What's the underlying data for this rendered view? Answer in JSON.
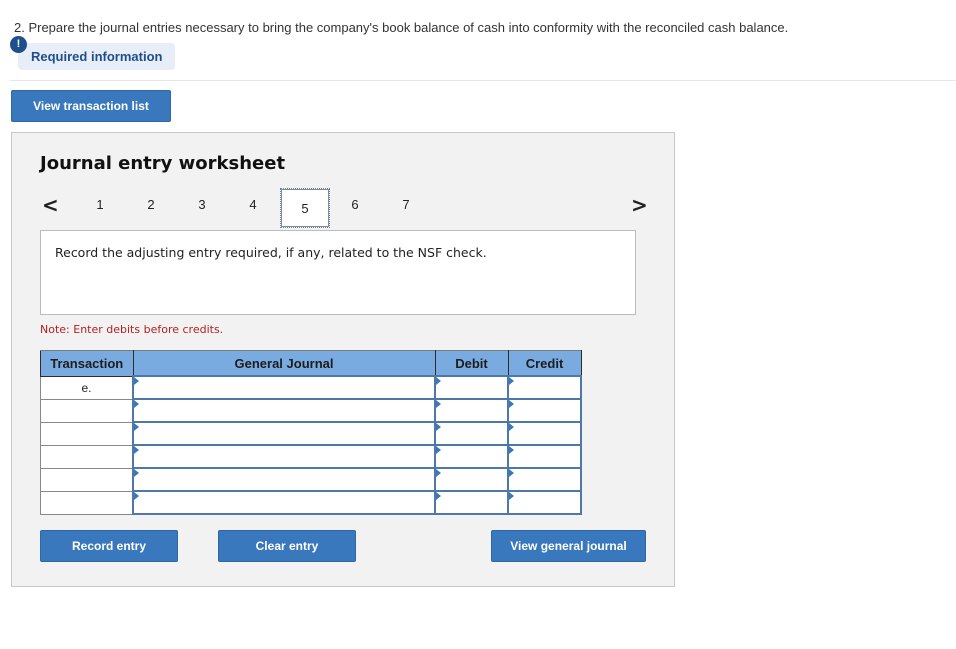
{
  "question": {
    "text": "2. Prepare the journal entries necessary to bring the company's book balance of cash into conformity with the reconciled cash balance."
  },
  "required_info": {
    "badge": "!",
    "label": "Required information"
  },
  "toolbar": {
    "view_transaction_list_label": "View transaction list"
  },
  "worksheet": {
    "title": "Journal entry worksheet",
    "nav": {
      "prev_icon": "chevron-left-icon",
      "next_icon": "chevron-right-icon",
      "prev_glyph": "<",
      "next_glyph": ">",
      "pages": [
        "1",
        "2",
        "3",
        "4",
        "5",
        "6",
        "7"
      ],
      "active_page": "5"
    },
    "prompt": "Record the adjusting entry required, if any, related to the NSF check.",
    "note": "Note: Enter debits before credits.",
    "table": {
      "headers": [
        "Transaction",
        "General Journal",
        "Debit",
        "Credit"
      ],
      "rows": [
        {
          "transaction": "e.",
          "account": "",
          "debit": "",
          "credit": ""
        },
        {
          "transaction": "",
          "account": "",
          "debit": "",
          "credit": ""
        },
        {
          "transaction": "",
          "account": "",
          "debit": "",
          "credit": ""
        },
        {
          "transaction": "",
          "account": "",
          "debit": "",
          "credit": ""
        },
        {
          "transaction": "",
          "account": "",
          "debit": "",
          "credit": ""
        },
        {
          "transaction": "",
          "account": "",
          "debit": "",
          "credit": ""
        }
      ]
    },
    "buttons": {
      "record": "Record entry",
      "clear": "Clear entry",
      "view_general_journal": "View general journal"
    }
  },
  "colors": {
    "primary_button": "#3a78bd",
    "table_header": "#79abe0",
    "note_text": "#b22222",
    "required_info_text": "#1f4e8c"
  }
}
